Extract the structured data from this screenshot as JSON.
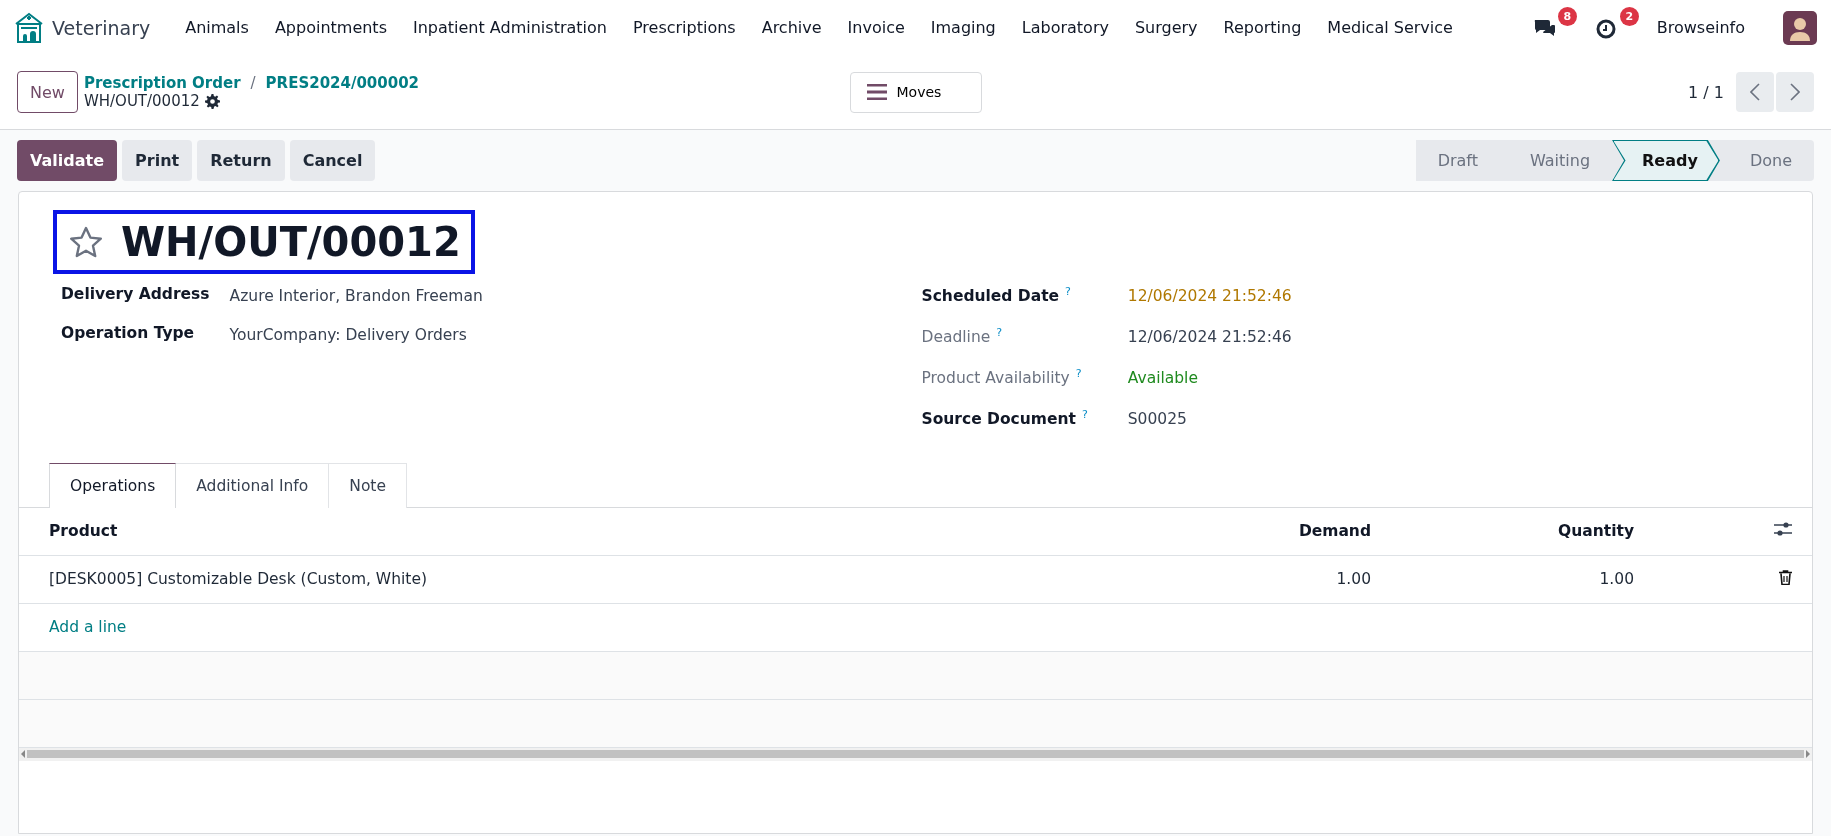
{
  "navbar": {
    "app_name": "Veterinary",
    "menu": [
      "Animals",
      "Appointments",
      "Inpatient Administration",
      "Prescriptions",
      "Archive",
      "Invoice",
      "Imaging",
      "Laboratory",
      "Surgery",
      "Reporting",
      "Medical Service"
    ],
    "messages_badge": "8",
    "activities_badge": "2",
    "user": "Browseinfo"
  },
  "control_panel": {
    "new_button": "New",
    "breadcrumbs": [
      "Prescription Order",
      "PRES2024/000002"
    ],
    "breadcrumb_separator": "/",
    "record": "WH/OUT/00012",
    "moves_button": "Moves",
    "pager": "1 / 1"
  },
  "actions": [
    {
      "label": "Validate",
      "kind": "primary"
    },
    {
      "label": "Print",
      "kind": "secondary"
    },
    {
      "label": "Return",
      "kind": "secondary"
    },
    {
      "label": "Cancel",
      "kind": "secondary"
    }
  ],
  "status_steps": [
    {
      "label": "Draft",
      "selected": false
    },
    {
      "label": "Waiting",
      "selected": false
    },
    {
      "label": "Ready",
      "selected": true
    },
    {
      "label": "Done",
      "selected": false
    }
  ],
  "form": {
    "title": "WH/OUT/00012",
    "favorite": false,
    "highlighted": true,
    "left_fields": [
      {
        "label": "Delivery Address",
        "value": "Azure Interior, Brandon Freeman",
        "required": true,
        "color": "#374151"
      },
      {
        "label": "Operation Type",
        "value": "YourCompany: Delivery Orders",
        "required": true,
        "color": "#374151"
      }
    ],
    "right_fields": [
      {
        "label": "Scheduled Date",
        "help": "?",
        "value": "12/06/2024 21:52:46",
        "required": true,
        "color": "#b07800"
      },
      {
        "label": "Deadline",
        "help": "?",
        "value": "12/06/2024 21:52:46",
        "required": false,
        "color": "#374151"
      },
      {
        "label": "Product Availability",
        "help": "?",
        "value": "Available",
        "required": false,
        "color": "#1f8a1f"
      },
      {
        "label": "Source Document",
        "help": "?",
        "value": "S00025",
        "required": true,
        "color": "#374151"
      }
    ]
  },
  "tabs": [
    {
      "label": "Operations",
      "selected": true
    },
    {
      "label": "Additional Info",
      "selected": false
    },
    {
      "label": "Note",
      "selected": false
    }
  ],
  "table": {
    "columns": [
      "Product",
      "Demand",
      "Quantity"
    ],
    "rows": [
      {
        "product": "[DESK0005] Customizable Desk (Custom, White)",
        "demand": "1.00",
        "quantity": "1.00"
      }
    ],
    "add_line": "Add a line"
  }
}
